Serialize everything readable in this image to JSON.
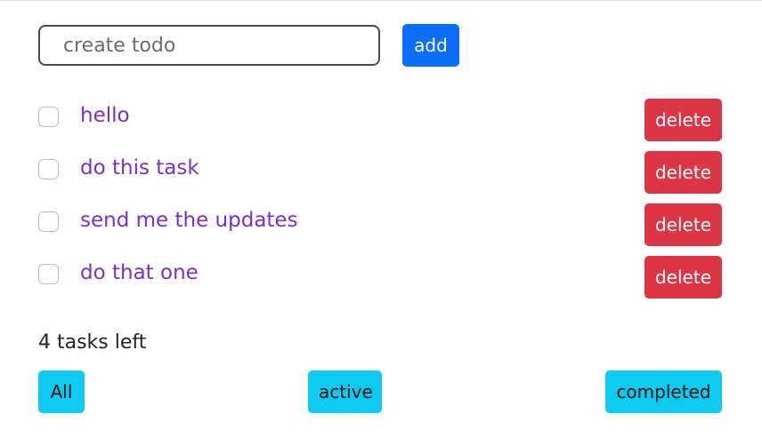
{
  "add_form": {
    "input_value": "",
    "input_placeholder": "create todo",
    "add_label": "add"
  },
  "todos": [
    {
      "text": "hello",
      "completed": false,
      "delete_label": "delete"
    },
    {
      "text": "do this task",
      "completed": false,
      "delete_label": "delete"
    },
    {
      "text": "send me the updates",
      "completed": false,
      "delete_label": "delete"
    },
    {
      "text": "do that one",
      "completed": false,
      "delete_label": "delete"
    }
  ],
  "footer": {
    "tasks_left": "4 tasks left",
    "filters": {
      "all": "All",
      "active": "active",
      "completed": "completed"
    }
  },
  "colors": {
    "primary": "#0d6efd",
    "danger": "#dc3545",
    "info": "#0dcaf0",
    "todo_text": "#7b2fd0"
  }
}
